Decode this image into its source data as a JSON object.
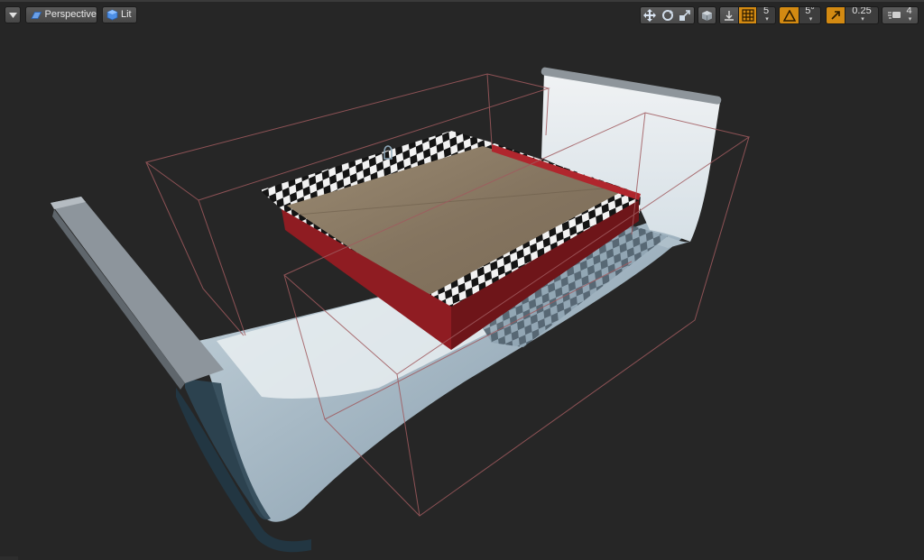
{
  "viewport": {
    "menu_icon": "chevron-down-icon",
    "view_mode": {
      "label": "Perspective",
      "icon": "perspective-icon"
    },
    "view_lighting": {
      "label": "Lit",
      "icon": "lit-sphere-icon"
    },
    "transform_tools": [
      "translate-icon",
      "rotate-icon",
      "scale-icon"
    ],
    "coordinate_space_icon": "world-cube-icon",
    "surface_snap_icon": "surface-snap-icon",
    "grid_snap": {
      "icon": "grid-snap-icon",
      "value": "5",
      "active": true
    },
    "rotation_snap": {
      "icon": "rotation-snap-icon",
      "value": "5°",
      "active": true
    },
    "scale_snap": {
      "icon": "scale-snap-icon",
      "value": "0.25",
      "active": true
    },
    "camera_speed": {
      "icon": "camera-speed-icon",
      "value": "4"
    },
    "accent_color": "#d38a12"
  }
}
